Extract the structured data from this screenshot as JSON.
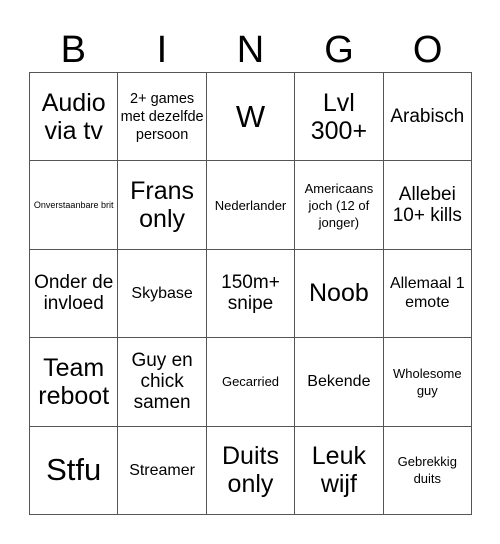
{
  "header": [
    "B",
    "I",
    "N",
    "G",
    "O"
  ],
  "cells": [
    {
      "text": "Audio via tv",
      "size": "s-l"
    },
    {
      "text": "2+ games met dezelfde persoon",
      "size": "s-ms"
    },
    {
      "text": "W",
      "size": "s-xl"
    },
    {
      "text": "Lvl 300+",
      "size": "s-l"
    },
    {
      "text": "Arabisch",
      "size": "s-m"
    },
    {
      "text": "Onverstaanbare brit",
      "size": "s-xs"
    },
    {
      "text": "Frans only",
      "size": "s-l"
    },
    {
      "text": "Nederlander",
      "size": "s-sm"
    },
    {
      "text": "Americaans joch (12 of jonger)",
      "size": "s-sm"
    },
    {
      "text": "Allebei 10+ kills",
      "size": "s-m"
    },
    {
      "text": "Onder de invloed",
      "size": "s-m"
    },
    {
      "text": "Skybase",
      "size": "s-s"
    },
    {
      "text": "150m+ snipe",
      "size": "s-m"
    },
    {
      "text": "Noob",
      "size": "s-l"
    },
    {
      "text": "Allemaal 1 emote",
      "size": "s-s"
    },
    {
      "text": "Team reboot",
      "size": "s-l"
    },
    {
      "text": "Guy en chick samen",
      "size": "s-m"
    },
    {
      "text": "Gecarried",
      "size": "s-sm"
    },
    {
      "text": "Bekende",
      "size": "s-s"
    },
    {
      "text": "Wholesome guy",
      "size": "s-sm"
    },
    {
      "text": "Stfu",
      "size": "s-xl"
    },
    {
      "text": "Streamer",
      "size": "s-s"
    },
    {
      "text": "Duits only",
      "size": "s-l"
    },
    {
      "text": "Leuk wijf",
      "size": "s-l"
    },
    {
      "text": "Gebrekkig duits",
      "size": "s-sm"
    }
  ]
}
